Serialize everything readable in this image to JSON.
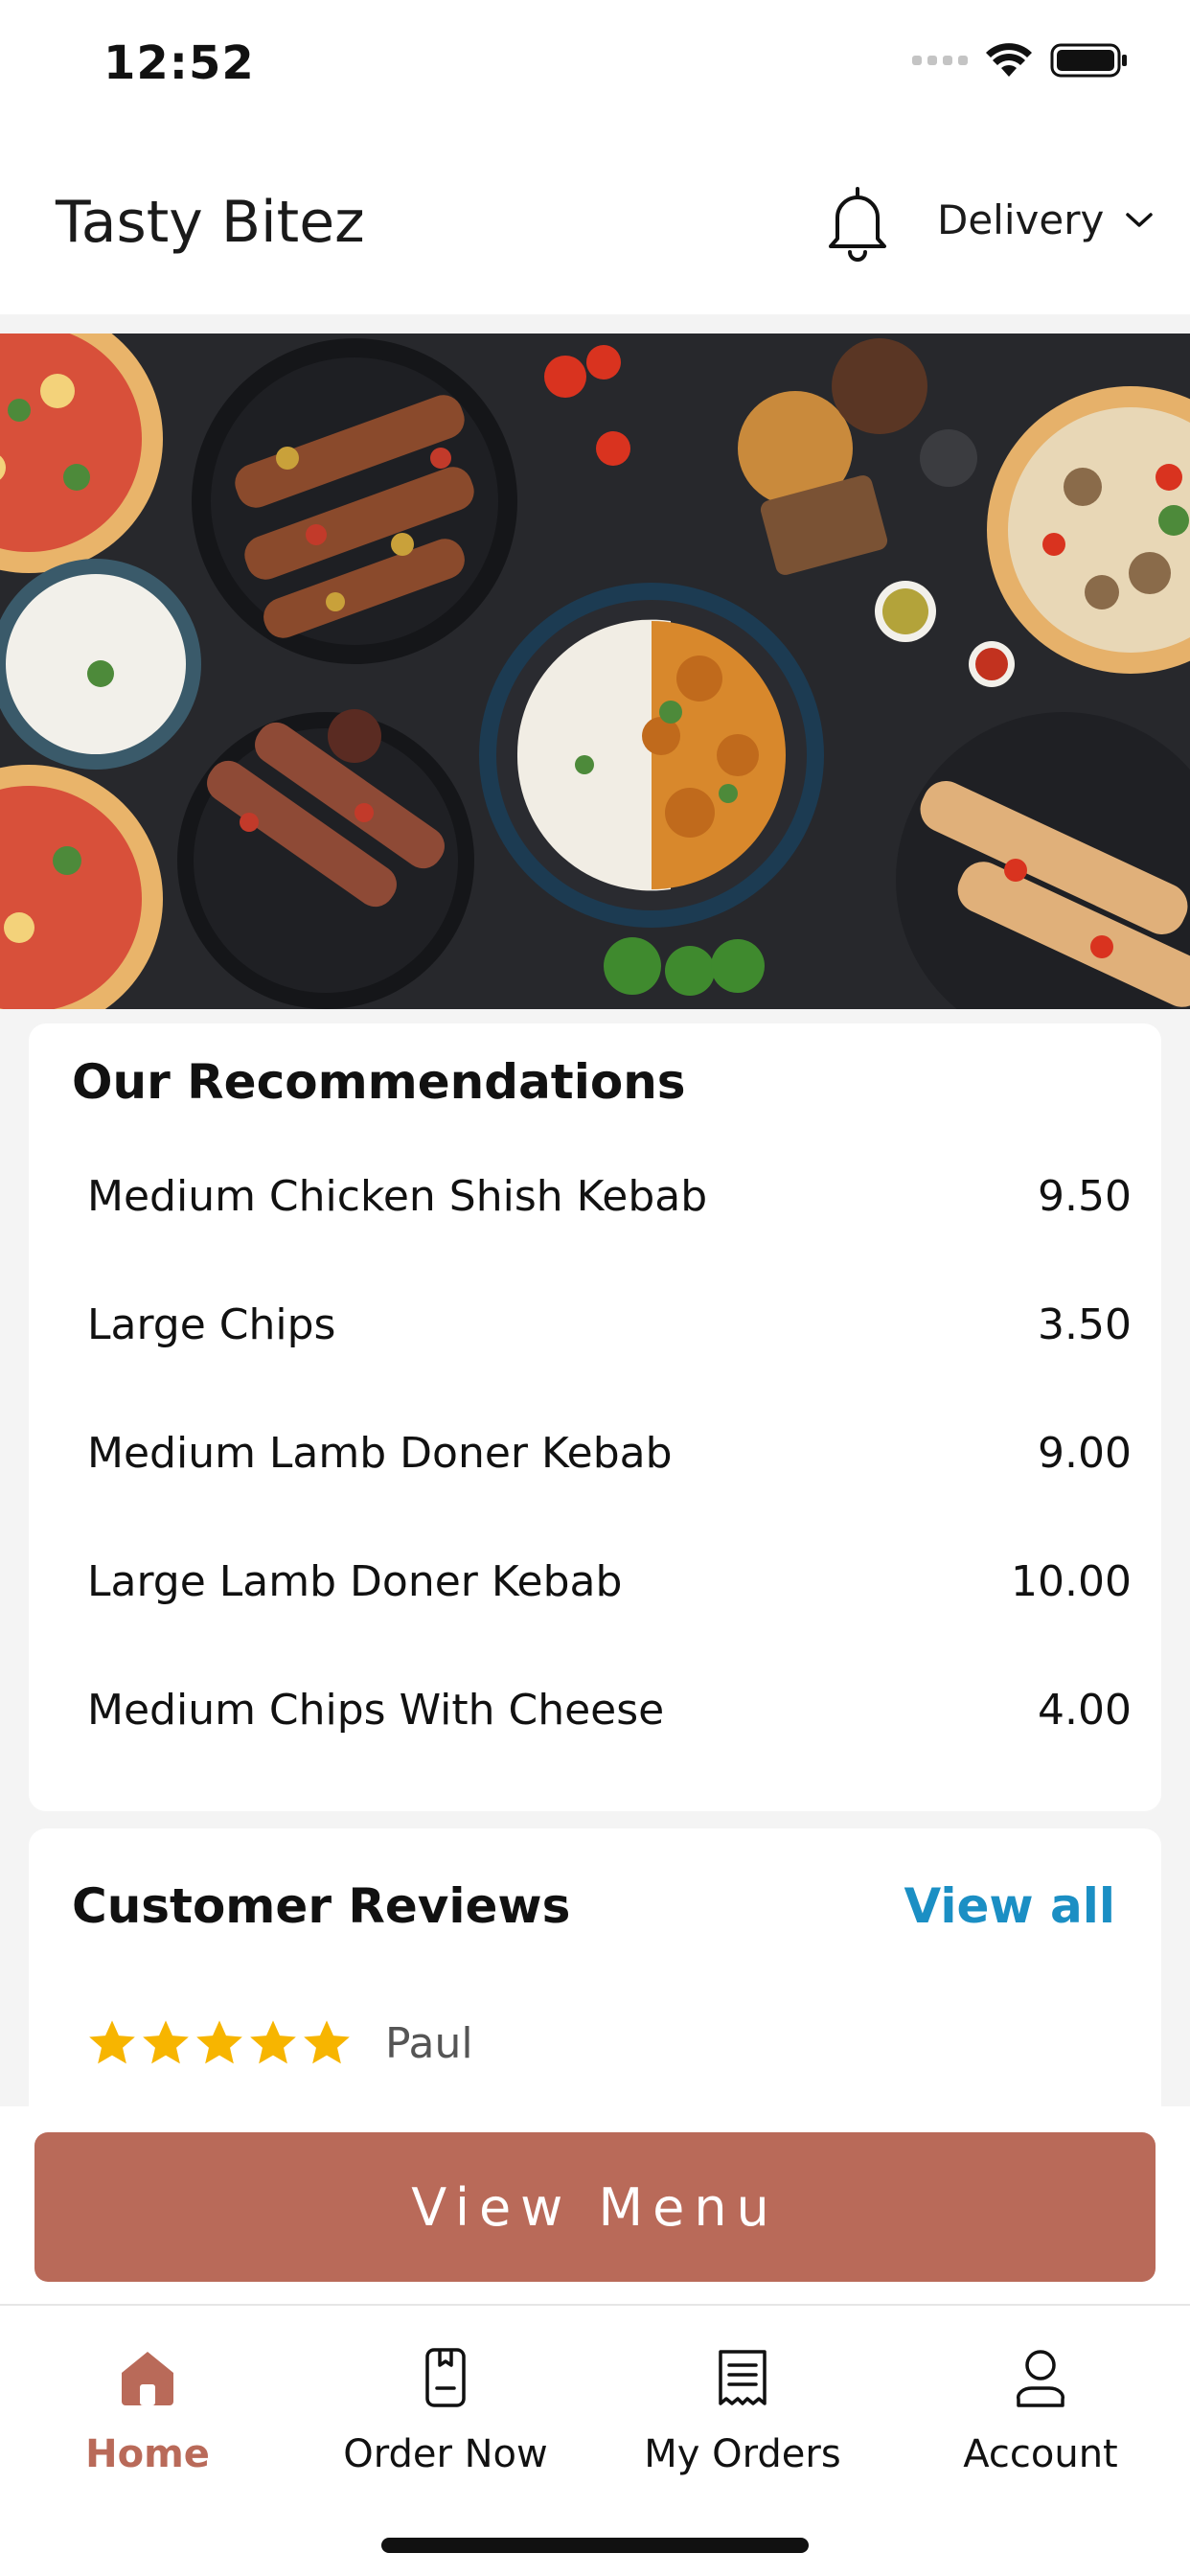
{
  "status_bar": {
    "time": "12:52"
  },
  "header": {
    "app_title": "Tasty Bitez",
    "order_mode": "Delivery",
    "icons": [
      "bell-icon",
      "chevron-down-icon"
    ]
  },
  "hero": {
    "icon": "food-banner-image"
  },
  "recommendations": {
    "title": "Our Recommendations",
    "items": [
      {
        "name": "Medium Chicken Shish Kebab",
        "price": "9.50"
      },
      {
        "name": "Large Chips",
        "price": "3.50"
      },
      {
        "name": "Medium Lamb Doner Kebab",
        "price": "9.00"
      },
      {
        "name": "Large Lamb Doner Kebab",
        "price": "10.00"
      },
      {
        "name": "Medium Chips With Cheese",
        "price": "4.00"
      }
    ]
  },
  "reviews": {
    "title": "Customer Reviews",
    "view_all_label": "View all",
    "items": [
      {
        "rating": 5,
        "max_rating": 5,
        "name": "Paul"
      }
    ]
  },
  "view_menu_label": "View Menu",
  "tabs": [
    {
      "label": "Home",
      "icon": "home-icon",
      "active": true
    },
    {
      "label": "Order Now",
      "icon": "order-icon",
      "active": false
    },
    {
      "label": "My Orders",
      "icon": "receipt-icon",
      "active": false
    },
    {
      "label": "Account",
      "icon": "user-icon",
      "active": false
    }
  ],
  "colors": {
    "accent": "#b96a59",
    "link": "#1b8fc4",
    "star": "#f7b500",
    "background": "#f4f4f4"
  }
}
